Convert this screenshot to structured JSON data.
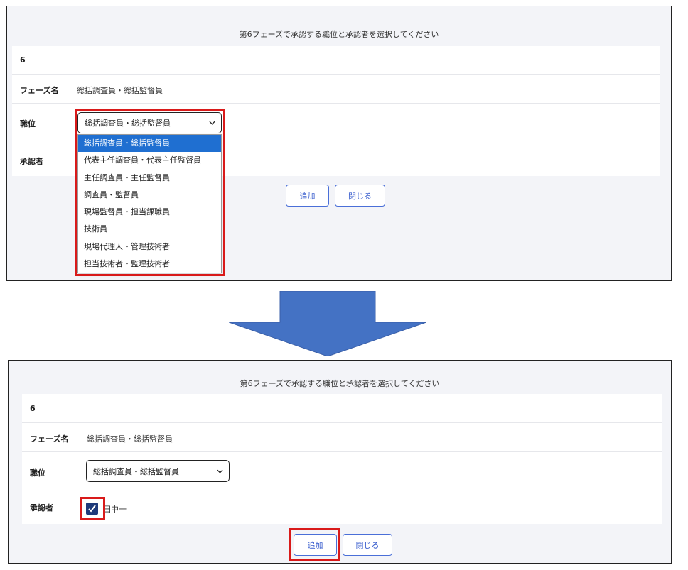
{
  "top": {
    "prompt": "第6フェーズで承認する職位と承認者を選択してください",
    "phase_number": "6",
    "phase_name_label": "フェーズ名",
    "phase_name_value": "総括調査員・総括監督員",
    "position_label": "職位",
    "position_selected": "総括調査員・総括監督員",
    "approver_label": "承認者",
    "dropdown_options": [
      "総括調査員・総括監督員",
      "代表主任調査員・代表主任監督員",
      "主任調査員・主任監督員",
      "調査員・監督員",
      "現場監督員・担当課職員",
      "技術員",
      "現場代理人・管理技術者",
      "担当技術者・監理技術者"
    ],
    "add_button": "追加",
    "close_button": "閉じる"
  },
  "bottom": {
    "prompt": "第6フェーズで承認する職位と承認者を選択してください",
    "phase_number": "6",
    "phase_name_label": "フェーズ名",
    "phase_name_value": "総括調査員・総括監督員",
    "position_label": "職位",
    "position_selected": "総括調査員・総括監督員",
    "approver_label": "承認者",
    "approver_name": "田中一",
    "approver_checked": true,
    "add_button": "追加",
    "close_button": "閉じる"
  },
  "colors": {
    "highlight": "#d91a1a",
    "selected_option": "#1f6fd1",
    "button_border": "#4a6fd8",
    "arrow_fill": "#4472c4",
    "checkbox_fill": "#1f3a7a"
  },
  "icons": {
    "dropdown": "chevron-down-icon",
    "check": "check-icon",
    "arrow": "down-arrow-icon"
  }
}
